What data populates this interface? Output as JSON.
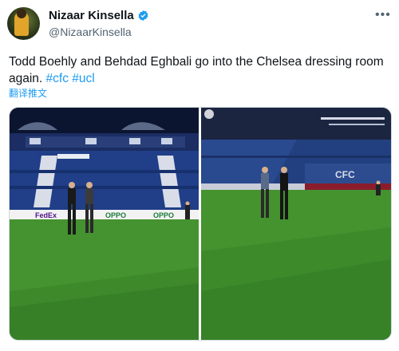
{
  "user": {
    "display_name": "Nizaar Kinsella",
    "handle": "@NizaarKinsella"
  },
  "tweet": {
    "text_main": "Todd Boehly and Behdad Eghbali go into the Chelsea dressing room again. ",
    "hashtags": [
      "#cfc",
      "#ucl"
    ],
    "translate_label": "翻译推文"
  },
  "media": {
    "left_photo": {
      "board_texts": [
        "FedEx",
        "OPPO",
        "OPPO"
      ]
    },
    "right_photo": {
      "board_texts": []
    }
  },
  "colors": {
    "accent": "#1d9bf0",
    "pitch": "#3f8a2c",
    "stand_blue": "#1f3f86"
  },
  "icons": {
    "verified": "verified-badge-icon",
    "more": "more-options-icon"
  }
}
